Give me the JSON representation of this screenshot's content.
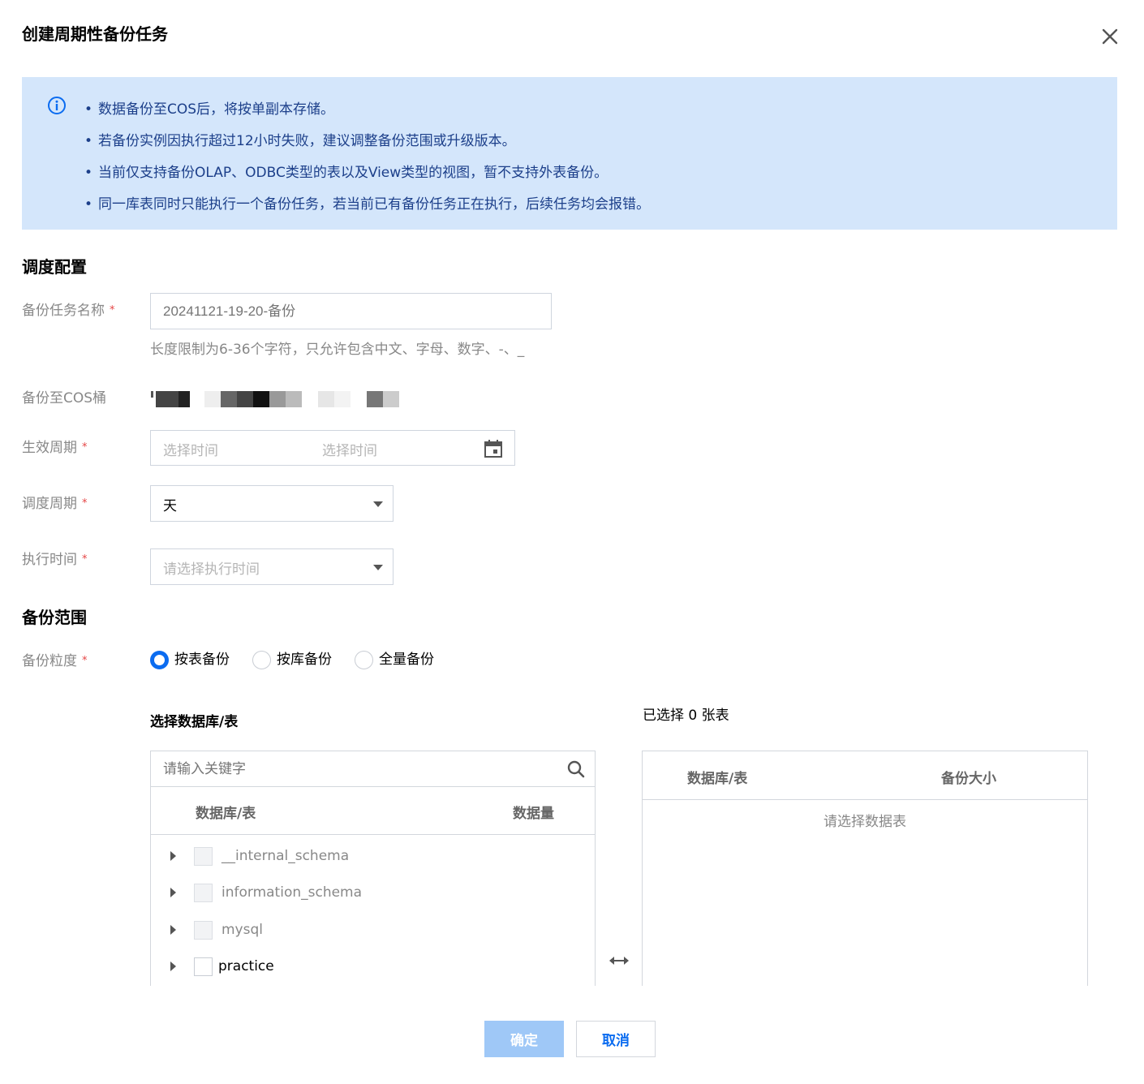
{
  "dialog": {
    "title": "创建周期性备份任务"
  },
  "notice": {
    "items": [
      "数据备份至COS后，将按单副本存储。",
      "若备份实例因执行超过12小时失败，建议调整备份范围或升级版本。",
      "当前仅支持备份OLAP、ODBC类型的表以及View类型的视图，暂不支持外表备份。",
      "同一库表同时只能执行一个备份任务，若当前已有备份任务正在执行，后续任务均会报错。"
    ]
  },
  "schedule": {
    "section_title": "调度配置",
    "task_name": {
      "label": "备份任务名称",
      "placeholder": "20241121-19-20-备份",
      "hint": "长度限制为6-36个字符，只允许包含中文、字母、数字、-、_"
    },
    "cos_bucket": {
      "label": "备份至COS桶"
    },
    "effective_period": {
      "label": "生效周期",
      "start_placeholder": "选择时间",
      "end_placeholder": "选择时间"
    },
    "schedule_cycle": {
      "label": "调度周期",
      "value": "天"
    },
    "exec_time": {
      "label": "执行时间",
      "placeholder": "请选择执行时间"
    },
    "required_mark": "*"
  },
  "scope": {
    "section_title": "备份范围",
    "granularity": {
      "label": "备份粒度",
      "options": [
        "按表备份",
        "按库备份",
        "全量备份"
      ],
      "selected": "按表备份"
    },
    "source": {
      "title": "选择数据库/表",
      "search_placeholder": "请输入关键字",
      "col_name": "数据库/表",
      "col_size": "数据量",
      "databases": [
        "__internal_schema",
        "information_schema",
        "mysql",
        "practice"
      ]
    },
    "target": {
      "title": "已选择 0 张表",
      "col_name": "数据库/表",
      "col_size": "备份大小",
      "empty_text": "请选择数据表"
    }
  },
  "footer": {
    "confirm_label": "确定",
    "cancel_label": "取消"
  },
  "colors": {
    "accent": "#0b6cf0",
    "notice_bg": "#d4e6fb",
    "notice_text": "#1c3f8a",
    "required": "#e54545",
    "primary_disabled": "#9fc8f7"
  }
}
